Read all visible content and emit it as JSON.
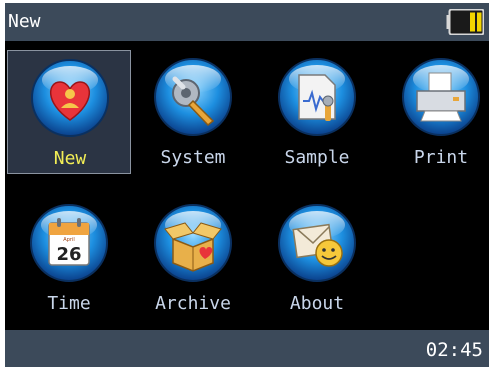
{
  "title": "New",
  "status": {
    "time": "02:45"
  },
  "battery": {
    "icon": "battery-icon",
    "fill_color": "#f2d500"
  },
  "menu": {
    "selected": "New",
    "items": [
      {
        "label": "New",
        "icon": "heart-icon"
      },
      {
        "label": "System",
        "icon": "wrench-gear-icon"
      },
      {
        "label": "Sample",
        "icon": "document-waveform-icon"
      },
      {
        "label": "Print",
        "icon": "printer-icon"
      },
      {
        "label": "Time",
        "icon": "calendar-icon",
        "icon_text": {
          "month": "April",
          "day": "26"
        }
      },
      {
        "label": "Archive",
        "icon": "open-box-icon"
      },
      {
        "label": "About",
        "icon": "smiley-envelope-icon"
      }
    ]
  },
  "colors": {
    "bar": "#3c4a5a",
    "screen": "#000000",
    "selected_label": "#f2ee56",
    "label": "#c9d6ea",
    "icon_globe": "#1d8fe0"
  }
}
